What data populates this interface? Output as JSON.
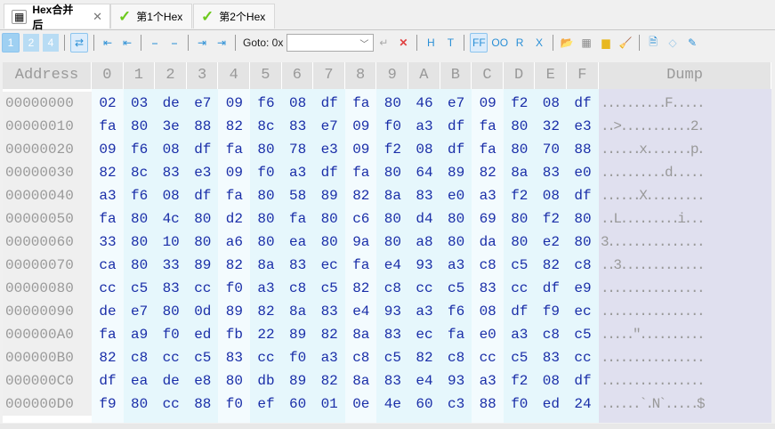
{
  "tabs": [
    {
      "label": "Hex合并后",
      "icon": "hex-file-icon",
      "active": true
    },
    {
      "label": "第1个Hex",
      "icon": "check-icon"
    },
    {
      "label": "第2个Hex",
      "icon": "check-icon"
    }
  ],
  "toolbar": {
    "view1": "1",
    "view2": "2",
    "view4": "4",
    "goto_label": "Goto: 0x",
    "goto_value": "",
    "h": "H",
    "t": "T",
    "ff": "FF",
    "oo": "OO",
    "r": "R",
    "x": "X"
  },
  "grid": {
    "address_header": "Address",
    "col_headers": [
      "0",
      "1",
      "2",
      "3",
      "4",
      "5",
      "6",
      "7",
      "8",
      "9",
      "A",
      "B",
      "C",
      "D",
      "E",
      "F"
    ],
    "dump_header": "Dump",
    "rows": [
      {
        "addr": "00000000",
        "hex": [
          "02",
          "03",
          "de",
          "e7",
          "09",
          "f6",
          "08",
          "df",
          "fa",
          "80",
          "46",
          "e7",
          "09",
          "f2",
          "08",
          "df"
        ],
        "dump": "..........F....."
      },
      {
        "addr": "00000010",
        "hex": [
          "fa",
          "80",
          "3e",
          "88",
          "82",
          "8c",
          "83",
          "e7",
          "09",
          "f0",
          "a3",
          "df",
          "fa",
          "80",
          "32",
          "e3"
        ],
        "dump": "..>...........2."
      },
      {
        "addr": "00000020",
        "hex": [
          "09",
          "f6",
          "08",
          "df",
          "fa",
          "80",
          "78",
          "e3",
          "09",
          "f2",
          "08",
          "df",
          "fa",
          "80",
          "70",
          "88"
        ],
        "dump": "......x.......p."
      },
      {
        "addr": "00000030",
        "hex": [
          "82",
          "8c",
          "83",
          "e3",
          "09",
          "f0",
          "a3",
          "df",
          "fa",
          "80",
          "64",
          "89",
          "82",
          "8a",
          "83",
          "e0"
        ],
        "dump": "..........d....."
      },
      {
        "addr": "00000040",
        "hex": [
          "a3",
          "f6",
          "08",
          "df",
          "fa",
          "80",
          "58",
          "89",
          "82",
          "8a",
          "83",
          "e0",
          "a3",
          "f2",
          "08",
          "df"
        ],
        "dump": "......X........."
      },
      {
        "addr": "00000050",
        "hex": [
          "fa",
          "80",
          "4c",
          "80",
          "d2",
          "80",
          "fa",
          "80",
          "c6",
          "80",
          "d4",
          "80",
          "69",
          "80",
          "f2",
          "80"
        ],
        "dump": "..L.........i..."
      },
      {
        "addr": "00000060",
        "hex": [
          "33",
          "80",
          "10",
          "80",
          "a6",
          "80",
          "ea",
          "80",
          "9a",
          "80",
          "a8",
          "80",
          "da",
          "80",
          "e2",
          "80"
        ],
        "dump": "3..............."
      },
      {
        "addr": "00000070",
        "hex": [
          "ca",
          "80",
          "33",
          "89",
          "82",
          "8a",
          "83",
          "ec",
          "fa",
          "e4",
          "93",
          "a3",
          "c8",
          "c5",
          "82",
          "c8"
        ],
        "dump": "..3............."
      },
      {
        "addr": "00000080",
        "hex": [
          "cc",
          "c5",
          "83",
          "cc",
          "f0",
          "a3",
          "c8",
          "c5",
          "82",
          "c8",
          "cc",
          "c5",
          "83",
          "cc",
          "df",
          "e9"
        ],
        "dump": "................"
      },
      {
        "addr": "00000090",
        "hex": [
          "de",
          "e7",
          "80",
          "0d",
          "89",
          "82",
          "8a",
          "83",
          "e4",
          "93",
          "a3",
          "f6",
          "08",
          "df",
          "f9",
          "ec"
        ],
        "dump": "................"
      },
      {
        "addr": "000000A0",
        "hex": [
          "fa",
          "a9",
          "f0",
          "ed",
          "fb",
          "22",
          "89",
          "82",
          "8a",
          "83",
          "ec",
          "fa",
          "e0",
          "a3",
          "c8",
          "c5"
        ],
        "dump": ".....\".........."
      },
      {
        "addr": "000000B0",
        "hex": [
          "82",
          "c8",
          "cc",
          "c5",
          "83",
          "cc",
          "f0",
          "a3",
          "c8",
          "c5",
          "82",
          "c8",
          "cc",
          "c5",
          "83",
          "cc"
        ],
        "dump": "................"
      },
      {
        "addr": "000000C0",
        "hex": [
          "df",
          "ea",
          "de",
          "e8",
          "80",
          "db",
          "89",
          "82",
          "8a",
          "83",
          "e4",
          "93",
          "a3",
          "f2",
          "08",
          "df"
        ],
        "dump": "................"
      },
      {
        "addr": "000000D0",
        "hex": [
          "f9",
          "80",
          "cc",
          "88",
          "f0",
          "ef",
          "60",
          "01",
          "0e",
          "4e",
          "60",
          "c3",
          "88",
          "f0",
          "ed",
          "24"
        ],
        "dump": "......`.N`.....$"
      }
    ]
  }
}
